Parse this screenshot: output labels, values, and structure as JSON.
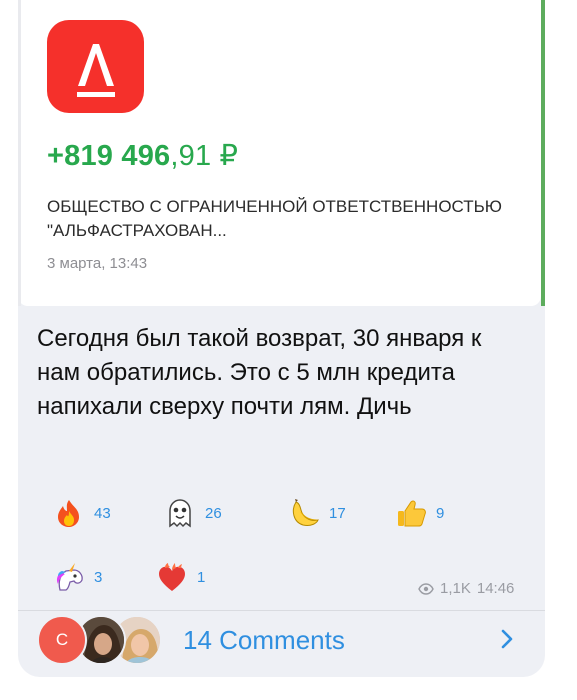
{
  "card": {
    "logo_letter": "А",
    "amount_main": "+819 496",
    "amount_frac": ",91 ₽",
    "company": "ОБЩЕСТВО С ОГРАНИЧЕННОЙ ОТВЕТСТВЕННОСТЬЮ \"АЛЬФАСТРАХОВАН...",
    "date": "3 марта, 13:43",
    "colors": {
      "logo": "#f5302b",
      "amount": "#28a84d",
      "accent": "#5dac5d"
    }
  },
  "message": {
    "text": "Сегодня был такой возврат, 30 января к нам обратились. Это с 5 млн кредита напихали сверху почти лям. Дичь"
  },
  "reactions": [
    {
      "icon": "fire-emoji",
      "count": "43"
    },
    {
      "icon": "ghost-emoji",
      "count": "26"
    },
    {
      "icon": "banana-emoji",
      "count": "17"
    },
    {
      "icon": "thumbs-up-emoji",
      "count": "9"
    },
    {
      "icon": "unicorn-emoji",
      "count": "3"
    },
    {
      "icon": "heart-on-fire-emoji",
      "count": "1"
    }
  ],
  "meta": {
    "views": "1,1K",
    "time": "14:46",
    "icon": "eye-icon"
  },
  "comments": {
    "avatar_letter": "C",
    "label": "14 Comments",
    "link_color": "#2f8fe0"
  }
}
